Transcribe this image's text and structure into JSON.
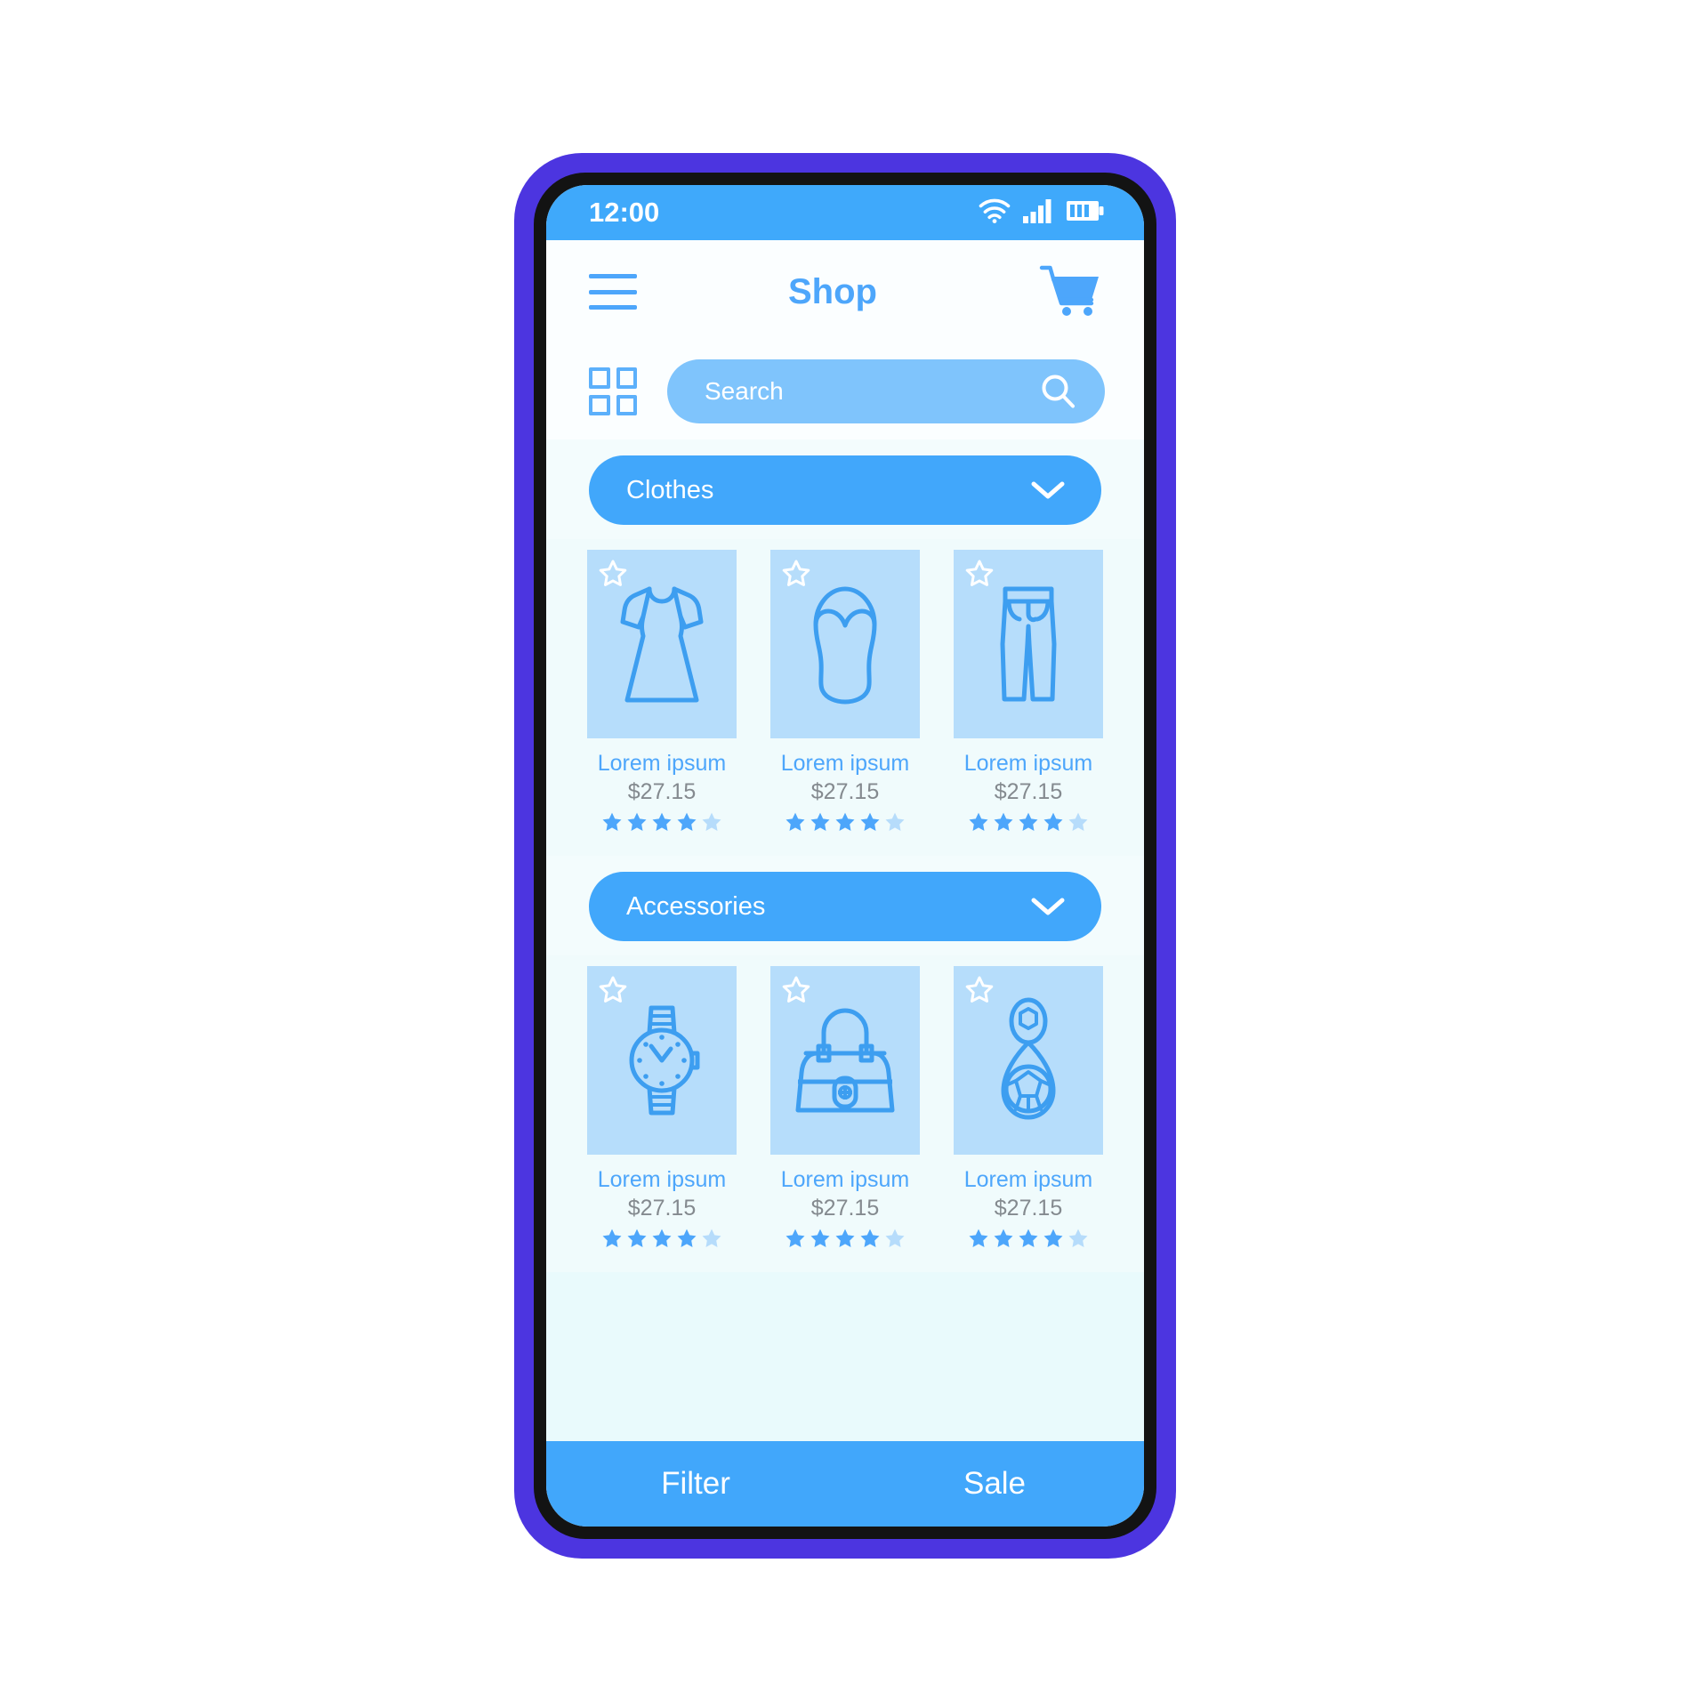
{
  "status_bar": {
    "time": "12:00",
    "icons": [
      "wifi-icon",
      "cellular-signal-icon",
      "battery-icon"
    ]
  },
  "header": {
    "menu_icon": "hamburger-menu-icon",
    "title": "Shop",
    "cart_icon": "shopping-cart-icon"
  },
  "search": {
    "grid_icon": "grid-view-icon",
    "placeholder": "Search",
    "value": "",
    "search_icon": "magnifier-icon"
  },
  "sections": [
    {
      "label": "Clothes",
      "chevron": "chevron-down-icon",
      "products": [
        {
          "art": "dress-icon",
          "name": "Lorem ipsum",
          "price": "$27.15",
          "rating": 4,
          "max_rating": 5,
          "favorite_icon": "star-outline-icon"
        },
        {
          "art": "swimsuit-icon",
          "name": "Lorem ipsum",
          "price": "$27.15",
          "rating": 4,
          "max_rating": 5,
          "favorite_icon": "star-outline-icon"
        },
        {
          "art": "jeans-icon",
          "name": "Lorem ipsum",
          "price": "$27.15",
          "rating": 4,
          "max_rating": 5,
          "favorite_icon": "star-outline-icon"
        }
      ]
    },
    {
      "label": "Accessories",
      "chevron": "chevron-down-icon",
      "products": [
        {
          "art": "watch-icon",
          "name": "Lorem ipsum",
          "price": "$27.15",
          "rating": 4,
          "max_rating": 5,
          "favorite_icon": "star-outline-icon"
        },
        {
          "art": "handbag-icon",
          "name": "Lorem ipsum",
          "price": "$27.15",
          "rating": 4,
          "max_rating": 5,
          "favorite_icon": "star-outline-icon"
        },
        {
          "art": "earring-icon",
          "name": "Lorem ipsum",
          "price": "$27.15",
          "rating": 4,
          "max_rating": 5,
          "favorite_icon": "star-outline-icon"
        }
      ]
    }
  ],
  "bottom_bar": {
    "filter_label": "Filter",
    "sale_label": "Sale"
  },
  "colors": {
    "frame_purple": "#4c35e0",
    "frame_black": "#131313",
    "status_blue": "#3fa9fb",
    "accent_blue": "#4da6fb",
    "category_blue": "#41a7fb",
    "search_pill_blue": "#7fc4fc",
    "thumb_blue": "#b6ddfb",
    "screen_bg": "#f3fcfd",
    "price_gray": "#848a8f",
    "star_light": "#b6dcfb"
  }
}
